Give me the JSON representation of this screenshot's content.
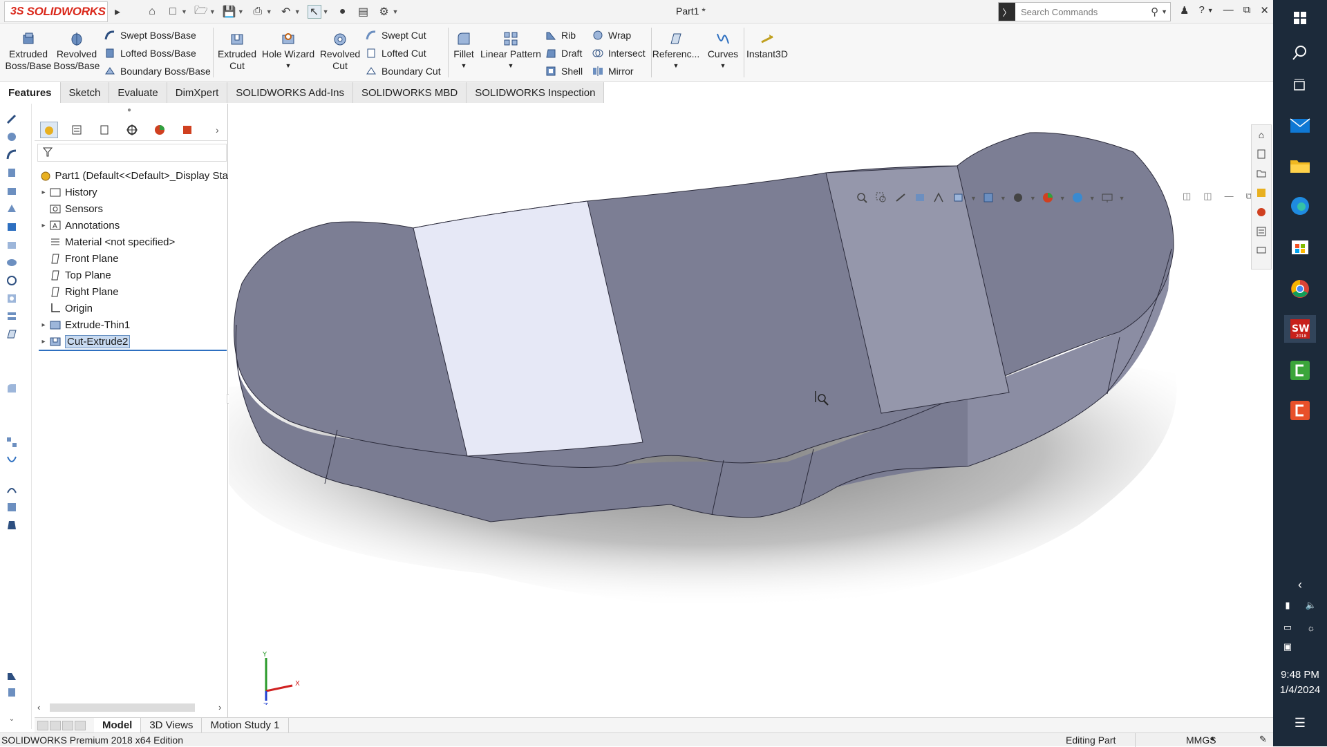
{
  "titlebar": {
    "logo_text": "SOLIDWORKS",
    "document_title": "Part1 *",
    "search_placeholder": "Search Commands"
  },
  "command_manager": {
    "extruded_boss": "Extruded\nBoss/Base",
    "revolved_boss": "Revolved\nBoss/Base",
    "swept_boss": "Swept Boss/Base",
    "lofted_boss": "Lofted Boss/Base",
    "boundary_boss": "Boundary Boss/Base",
    "extruded_cut": "Extruded\nCut",
    "hole_wizard": "Hole Wizard",
    "revolved_cut": "Revolved\nCut",
    "swept_cut": "Swept Cut",
    "lofted_cut": "Lofted Cut",
    "boundary_cut": "Boundary Cut",
    "fillet": "Fillet",
    "linear_pattern": "Linear Pattern",
    "rib": "Rib",
    "draft": "Draft",
    "shell": "Shell",
    "wrap": "Wrap",
    "intersect": "Intersect",
    "mirror": "Mirror",
    "reference": "Referenc...",
    "curves": "Curves",
    "instant3d": "Instant3D"
  },
  "tabs": [
    "Features",
    "Sketch",
    "Evaluate",
    "DimXpert",
    "SOLIDWORKS Add-Ins",
    "SOLIDWORKS MBD",
    "SOLIDWORKS Inspection"
  ],
  "feature_tree": {
    "root": "Part1  (Default<<Default>_Display Sta",
    "items": [
      {
        "label": "History"
      },
      {
        "label": "Sensors"
      },
      {
        "label": "Annotations"
      },
      {
        "label": "Material <not specified>"
      },
      {
        "label": "Front Plane"
      },
      {
        "label": "Top Plane"
      },
      {
        "label": "Right Plane"
      },
      {
        "label": "Origin"
      },
      {
        "label": "Extrude-Thin1"
      },
      {
        "label": "Cut-Extrude2"
      }
    ]
  },
  "triad": {
    "x": "X",
    "y": "Y",
    "z": "Z"
  },
  "bottom_tabs": [
    "Model",
    "3D Views",
    "Motion Study 1"
  ],
  "status_bar": {
    "edition": "SOLIDWORKS Premium 2018 x64 Edition",
    "mode": "Editing Part",
    "units": "MMGS"
  },
  "taskbar": {
    "time": "9:48 PM",
    "date": "1/4/2024",
    "sw_badge": "2018"
  },
  "colors": {
    "accent": "#da291c",
    "part_face": "#7d7f95",
    "part_face_light": "#e6e8f6",
    "taskbar": "#1c2a3a"
  }
}
